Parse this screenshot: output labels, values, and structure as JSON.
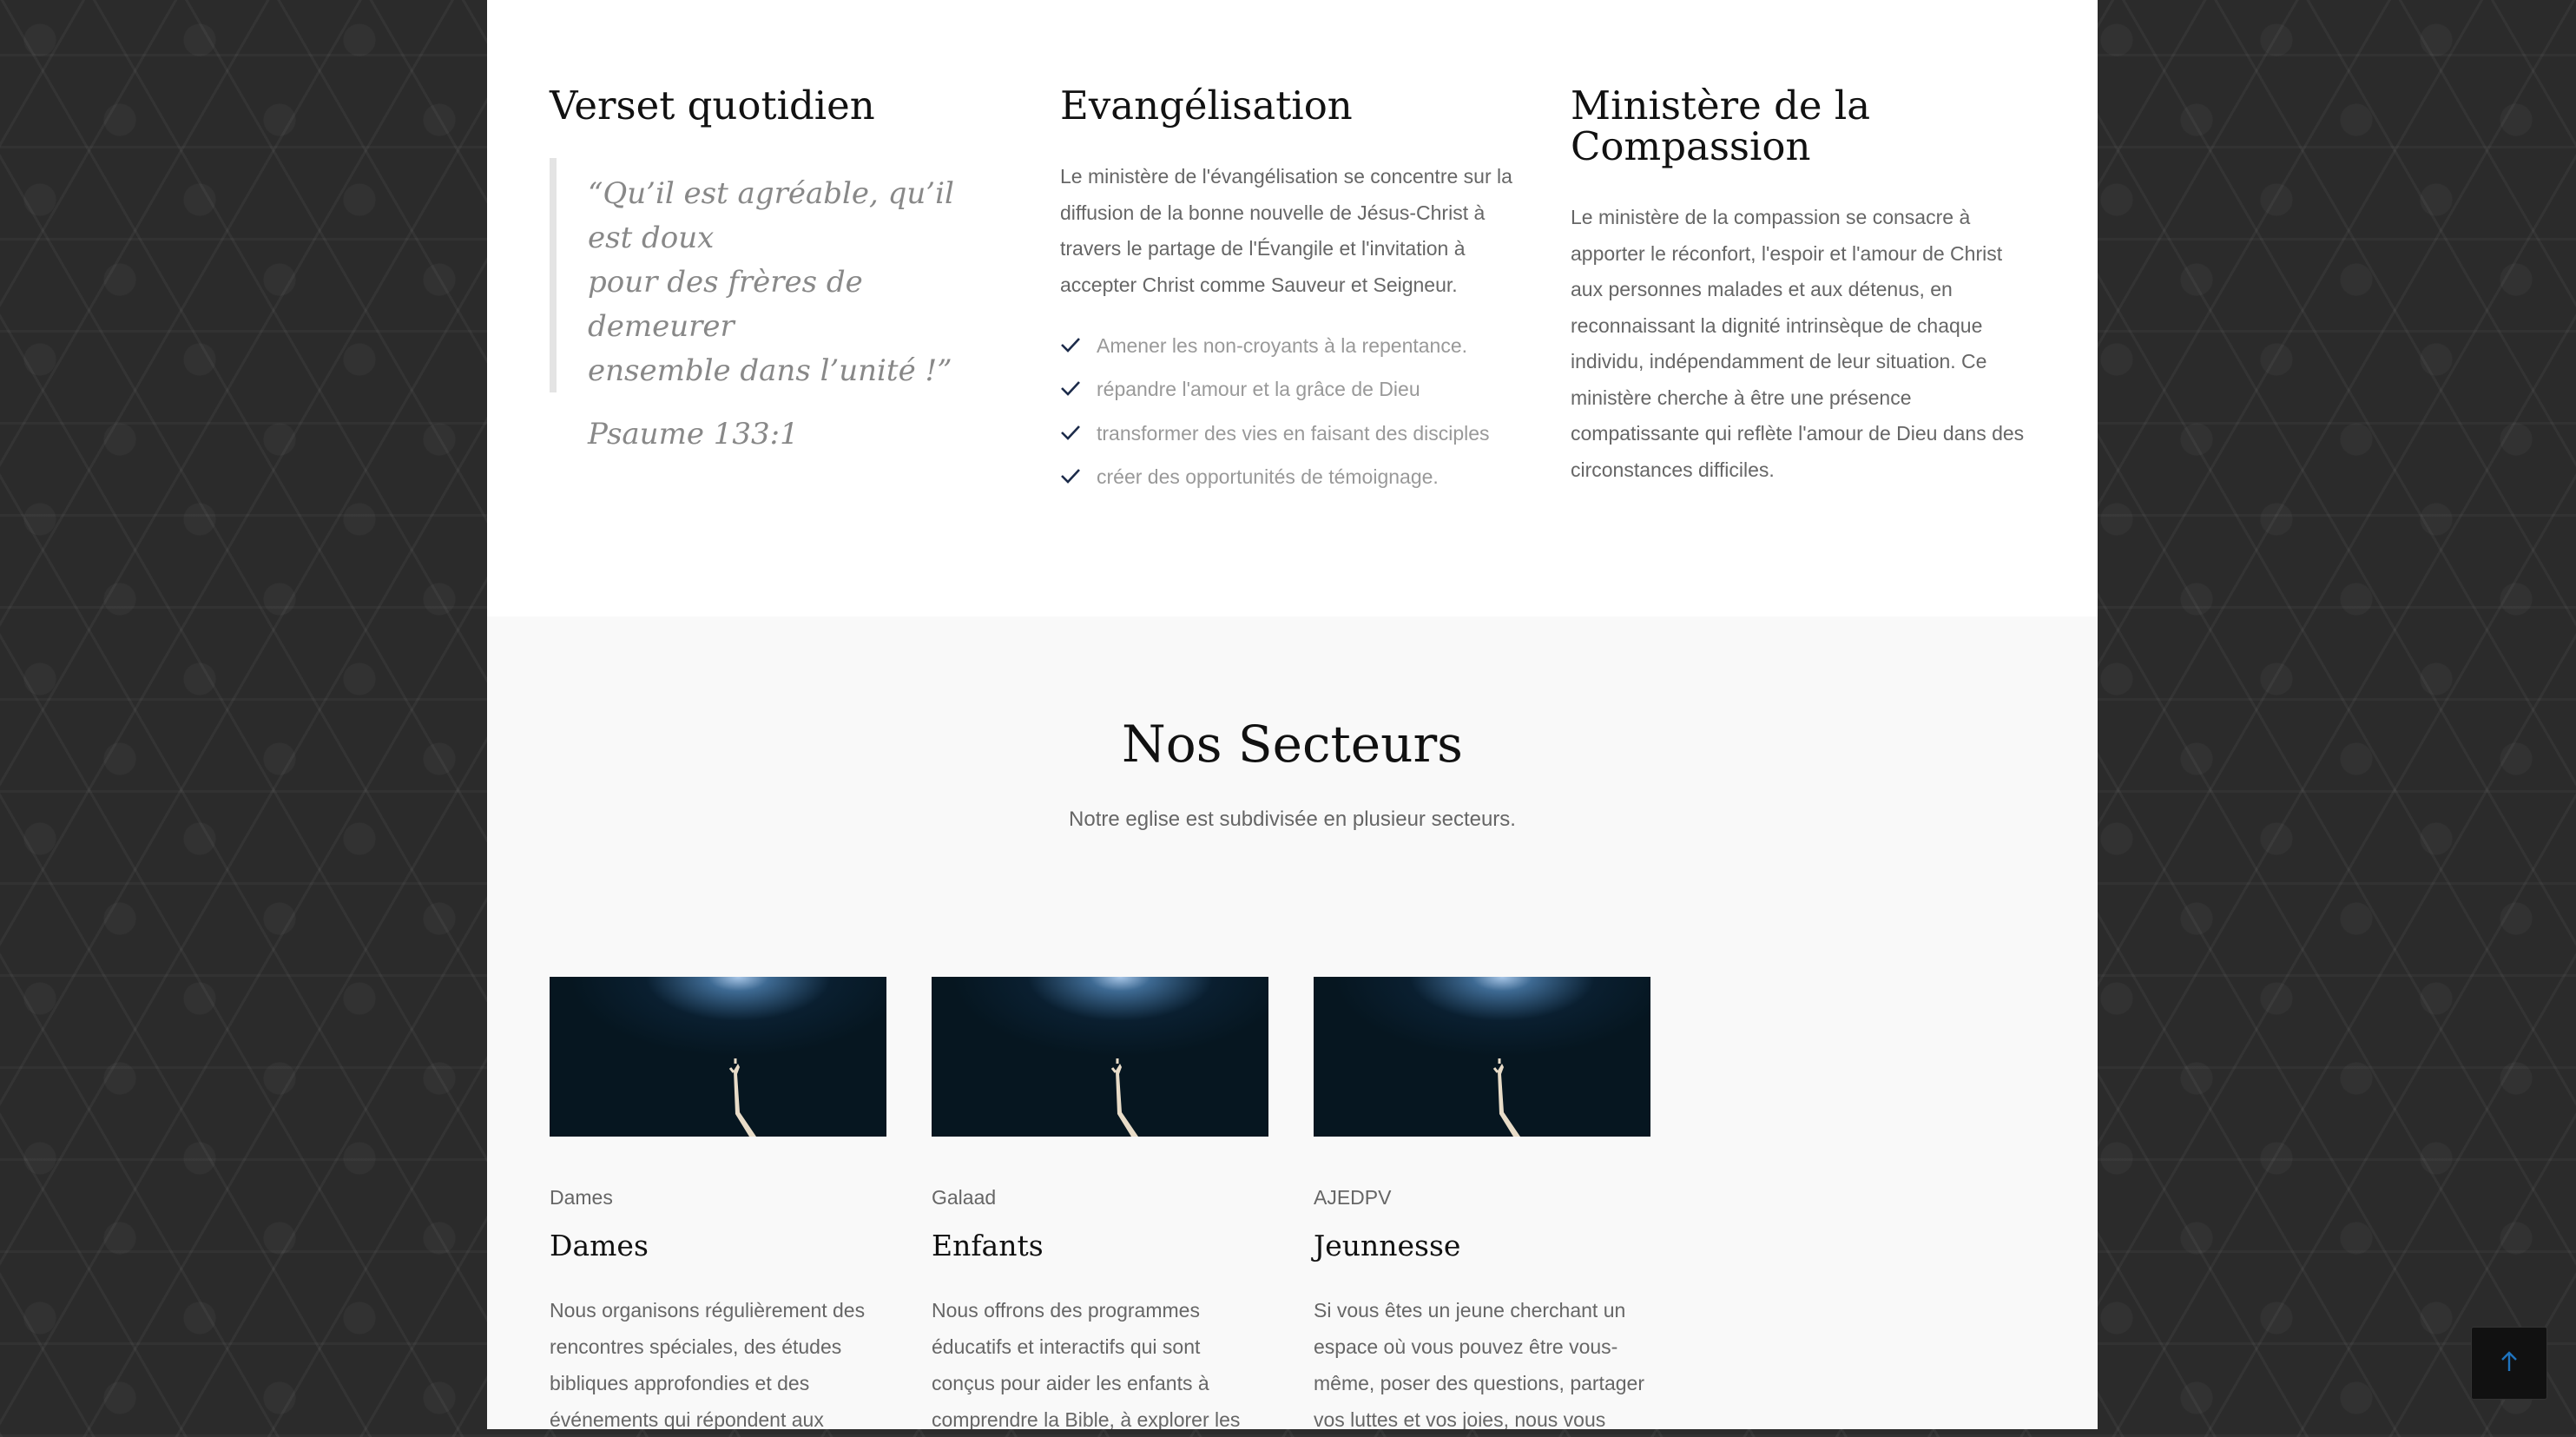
{
  "verse": {
    "title": "Verset quotidien",
    "quote_lines": [
      "“Qu’il est agréable, qu’il est doux",
      "pour des frères de demeurer",
      "ensemble dans l’unité !”"
    ],
    "reference": "Psaume 133:1"
  },
  "evangelisation": {
    "title": "Evangélisation",
    "text_lines": [
      "Le ministère de l'évangélisation se concentre sur la",
      "diffusion de la bonne nouvelle de Jésus-Christ à",
      "travers le partage de l'Évangile et l'invitation à",
      "accepter Christ comme Sauveur et Seigneur."
    ],
    "items": [
      "Amener les non-croyants à la repentance.",
      "répandre l'amour et la grâce de Dieu",
      "transformer des vies en faisant des disciples",
      "créer des opportunités de témoignage."
    ],
    "check_icon": "check-icon",
    "accent_color": "#1c2b4a"
  },
  "compassion": {
    "title_lines": [
      "Ministère de la",
      "Compassion"
    ],
    "text_lines": [
      "Le ministère de la compassion se consacre à",
      "apporter le réconfort, l'espoir et l'amour de Christ",
      "aux personnes malades et aux détenus, en",
      "reconnaissant la dignité intrinsèque de chaque",
      "individu, indépendamment de leur situation. Ce",
      "ministère cherche à être une présence",
      "compatissante qui reflète l'amour de Dieu dans des",
      "circonstances difficiles."
    ]
  },
  "sectors": {
    "title": "Nos Secteurs",
    "subtitle": "Notre eglise est subdivisée en plusieur secteurs.",
    "cards": [
      {
        "category": "Dames",
        "title": "Dames",
        "desc_lines": [
          "Nous organisons régulièrement des",
          "rencontres spéciales, des études",
          "bibliques approfondies et des",
          "événements qui répondent aux"
        ]
      },
      {
        "category": "Galaad",
        "title": "Enfants",
        "desc_lines": [
          "Nous offrons des programmes",
          "éducatifs et interactifs qui sont",
          "conçus pour aider les enfants à",
          "comprendre la Bible, à explorer les"
        ]
      },
      {
        "category": "AJEDPV",
        "title": "Jeunnesse",
        "desc_lines": [
          "Si vous êtes un jeune cherchant un",
          "espace où vous pouvez être vous-",
          "même, poser des questions, partager",
          "vos luttes et vos joies, nous vous"
        ]
      }
    ]
  },
  "scroll_top": {
    "icon": "arrow-up-icon",
    "color": "#1e73be"
  }
}
